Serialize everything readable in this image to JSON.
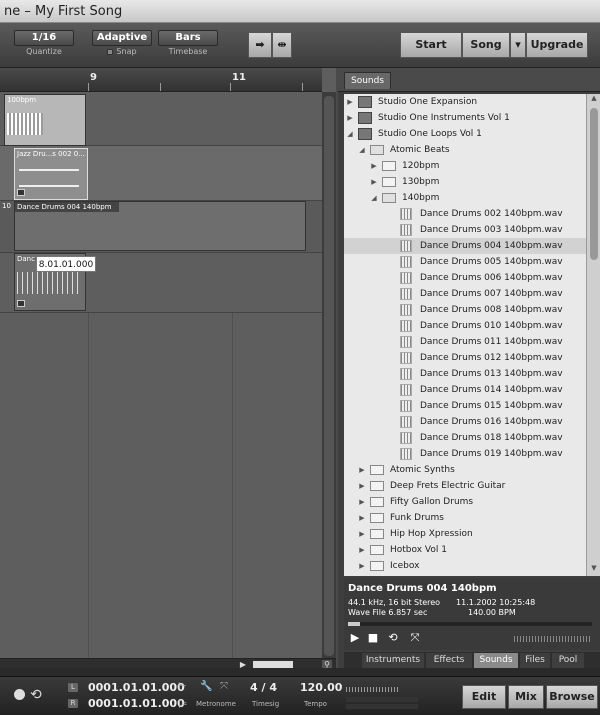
{
  "window": {
    "title": "ne – My First Song"
  },
  "toolbar": {
    "quantize": {
      "value": "1/16",
      "caption": "Quantize"
    },
    "snap": {
      "value": "Adaptive",
      "caption": "Snap"
    },
    "timebase": {
      "value": "Bars",
      "caption": "Timebase"
    },
    "start_label": "Start",
    "song_label": "Song",
    "upgrade_label": "Upgrade"
  },
  "arrange": {
    "ruler": [
      "9",
      "11"
    ],
    "events": [
      {
        "label": "100bpm"
      },
      {
        "label": "Jazz Dru...s 002 0..."
      },
      {
        "label": "Dance Drums 004 140bpm"
      },
      {
        "label": "Danc"
      }
    ],
    "track_number": "10",
    "tooltip": "8.01.01.000"
  },
  "browser": {
    "top_tab": "Sounds",
    "tree": [
      {
        "label": "Studio One Expansion",
        "indent": 0,
        "icon": "package-icon",
        "state": "collapsed"
      },
      {
        "label": "Studio One Instruments Vol 1",
        "indent": 0,
        "icon": "package-icon",
        "state": "collapsed"
      },
      {
        "label": "Studio One Loops Vol 1",
        "indent": 0,
        "icon": "package-icon",
        "state": "expanded"
      },
      {
        "label": "Atomic Beats",
        "indent": 1,
        "icon": "folder-open-icon",
        "state": "expanded"
      },
      {
        "label": "120bpm",
        "indent": 2,
        "icon": "folder-icon",
        "state": "collapsed"
      },
      {
        "label": "130bpm",
        "indent": 2,
        "icon": "folder-icon",
        "state": "collapsed"
      },
      {
        "label": "140bpm",
        "indent": 2,
        "icon": "folder-open-icon",
        "state": "expanded"
      },
      {
        "label": "Dance Drums 002 140bpm.wav",
        "indent": 3,
        "icon": "wav-file-icon",
        "state": "none"
      },
      {
        "label": "Dance Drums 003 140bpm.wav",
        "indent": 3,
        "icon": "wav-file-icon",
        "state": "none"
      },
      {
        "label": "Dance Drums 004 140bpm.wav",
        "indent": 3,
        "icon": "wav-file-icon",
        "state": "none",
        "selected": true
      },
      {
        "label": "Dance Drums 005 140bpm.wav",
        "indent": 3,
        "icon": "wav-file-icon",
        "state": "none"
      },
      {
        "label": "Dance Drums 006 140bpm.wav",
        "indent": 3,
        "icon": "wav-file-icon",
        "state": "none"
      },
      {
        "label": "Dance Drums 007 140bpm.wav",
        "indent": 3,
        "icon": "wav-file-icon",
        "state": "none"
      },
      {
        "label": "Dance Drums 008 140bpm.wav",
        "indent": 3,
        "icon": "wav-file-icon",
        "state": "none"
      },
      {
        "label": "Dance Drums 010 140bpm.wav",
        "indent": 3,
        "icon": "wav-file-icon",
        "state": "none"
      },
      {
        "label": "Dance Drums 011 140bpm.wav",
        "indent": 3,
        "icon": "wav-file-icon",
        "state": "none"
      },
      {
        "label": "Dance Drums 012 140bpm.wav",
        "indent": 3,
        "icon": "wav-file-icon",
        "state": "none"
      },
      {
        "label": "Dance Drums 013 140bpm.wav",
        "indent": 3,
        "icon": "wav-file-icon",
        "state": "none"
      },
      {
        "label": "Dance Drums 014 140bpm.wav",
        "indent": 3,
        "icon": "wav-file-icon",
        "state": "none"
      },
      {
        "label": "Dance Drums 015 140bpm.wav",
        "indent": 3,
        "icon": "wav-file-icon",
        "state": "none"
      },
      {
        "label": "Dance Drums 016 140bpm.wav",
        "indent": 3,
        "icon": "wav-file-icon",
        "state": "none"
      },
      {
        "label": "Dance Drums 018 140bpm.wav",
        "indent": 3,
        "icon": "wav-file-icon",
        "state": "none"
      },
      {
        "label": "Dance Drums 019 140bpm.wav",
        "indent": 3,
        "icon": "wav-file-icon",
        "state": "none"
      },
      {
        "label": "Atomic Synths",
        "indent": 1,
        "icon": "folder-icon",
        "state": "collapsed"
      },
      {
        "label": "Deep Frets Electric Guitar",
        "indent": 1,
        "icon": "folder-icon",
        "state": "collapsed"
      },
      {
        "label": "Fifty Gallon Drums",
        "indent": 1,
        "icon": "folder-icon",
        "state": "collapsed"
      },
      {
        "label": "Funk Drums",
        "indent": 1,
        "icon": "folder-icon",
        "state": "collapsed"
      },
      {
        "label": "Hip Hop Xpression",
        "indent": 1,
        "icon": "folder-icon",
        "state": "collapsed"
      },
      {
        "label": "Hotbox Vol 1",
        "indent": 1,
        "icon": "folder-icon",
        "state": "collapsed"
      },
      {
        "label": "Icebox",
        "indent": 1,
        "icon": "folder-icon",
        "state": "collapsed"
      }
    ],
    "info": {
      "title": "Dance Drums 004 140bpm",
      "format": "44.1 kHz, 16 bit Stereo",
      "datetime": "11.1.2002 10:25:48",
      "type_length": "Wave File   6.857 sec",
      "bpm": "140.00 BPM",
      "progress": 0.05
    },
    "bottom_tabs": [
      "Instruments",
      "Effects",
      "Sounds",
      "Files",
      "Pool"
    ],
    "active_bottom_tab": "Sounds"
  },
  "transport": {
    "left_marker": "L",
    "right_marker": "R",
    "left_time": "0001.01.01.000",
    "right_time": "0001.01.01.000",
    "metronome_label": "Metronome",
    "timesig_value": "4 / 4",
    "timesig_label": "Timesig",
    "tempo_value": "120.00",
    "tempo_label": "Tempo",
    "edit_label": "Edit",
    "mix_label": "Mix",
    "browse_label": "Browse"
  },
  "colors": {
    "selection": "#d2d2d2",
    "panel_dark": "#3e3e3e",
    "active_tab": "#8a8a8a"
  }
}
